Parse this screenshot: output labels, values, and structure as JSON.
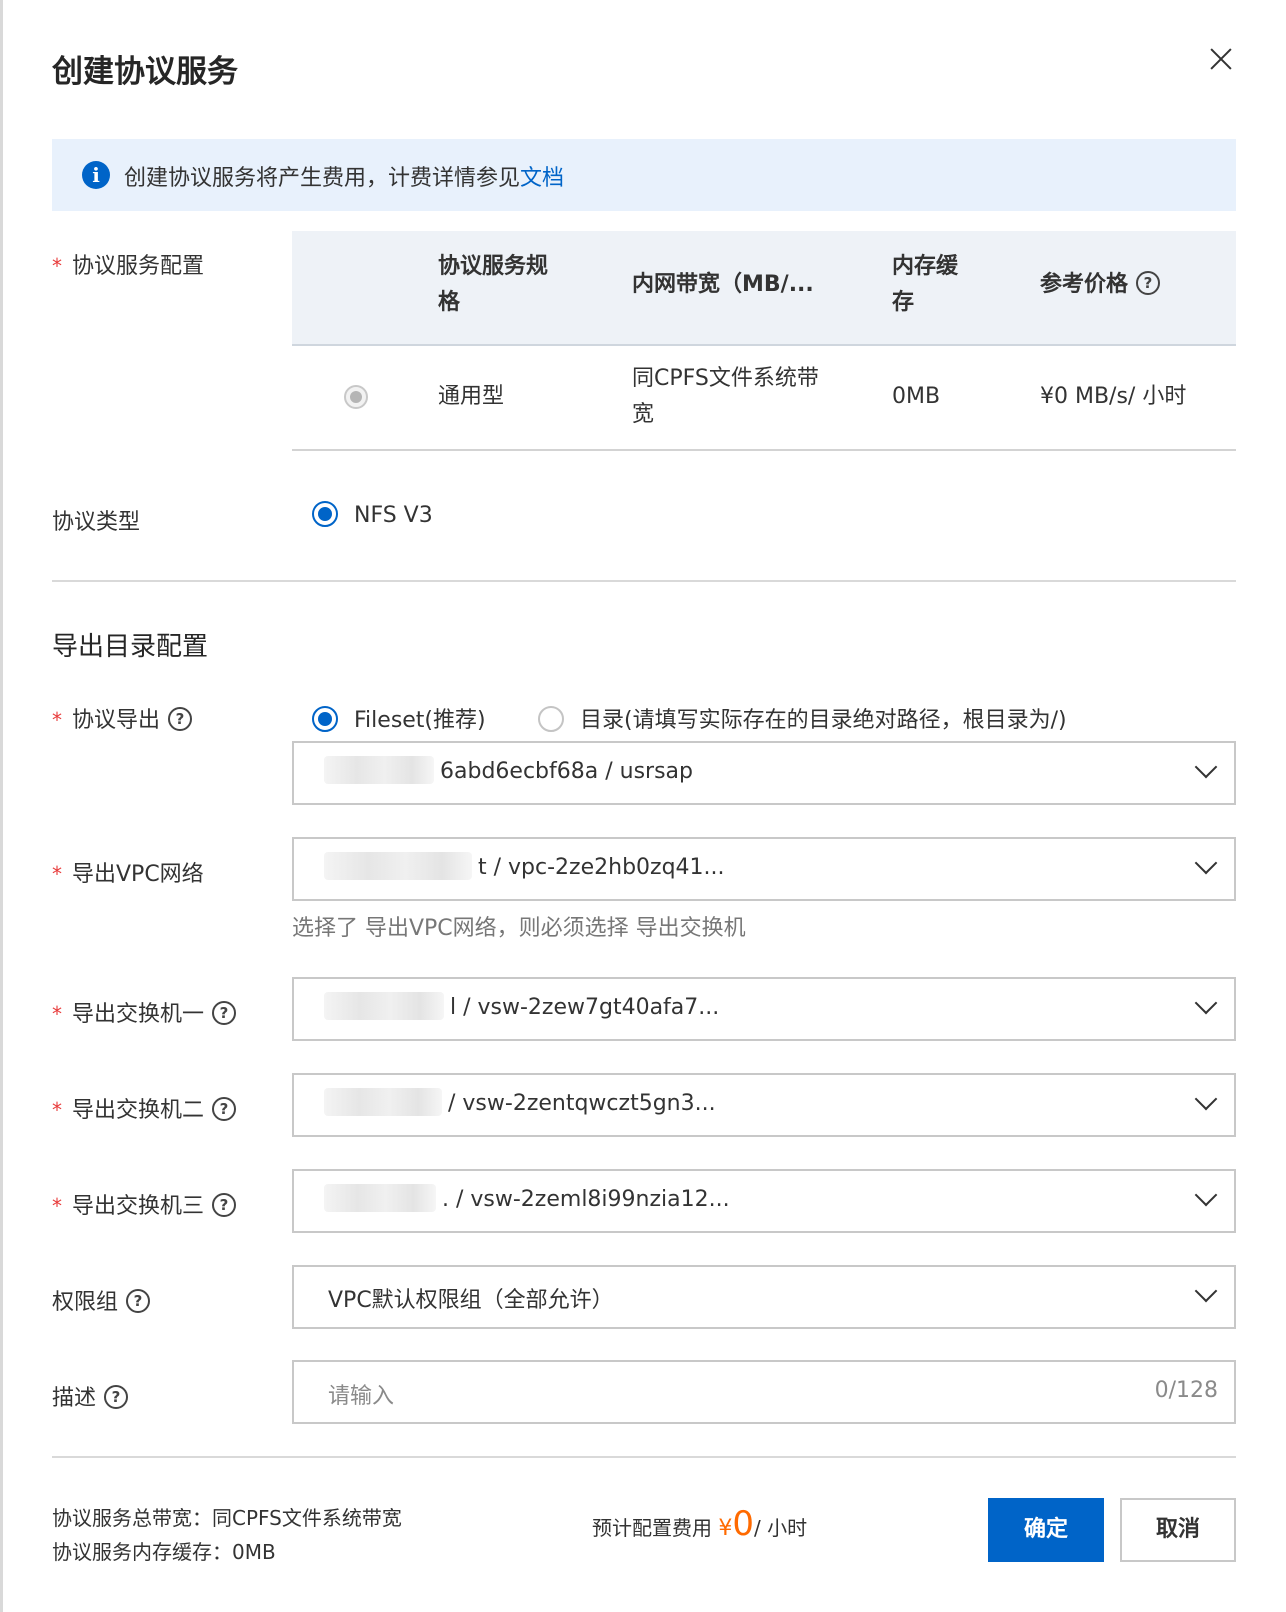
{
  "dialog": {
    "title": "创建协议服务"
  },
  "notice": {
    "text": "创建协议服务将产生费用，计费详情参见",
    "link": "文档"
  },
  "spec": {
    "label": "协议服务配置",
    "headers": [
      "协议服务规格",
      "内网带宽（MB/...",
      "内存缓存",
      "参考价格"
    ],
    "row": {
      "spec": "通用型",
      "bandwidth": "同CPFS文件系统带宽",
      "cache": "0MB",
      "price": "¥0 MB/s/ 小时"
    }
  },
  "protocol_type": {
    "label": "协议类型",
    "option": "NFS V3"
  },
  "export_section": {
    "title": "导出目录配置"
  },
  "protocol_export": {
    "label": "协议导出",
    "options": [
      "Fileset(推荐)",
      "目录(请填写实际存在的目录绝对路径，根目录为/)"
    ],
    "value": "6abd6ecbf68a / usrsap"
  },
  "vpc": {
    "label": "导出VPC网络",
    "value": "t / vpc-2ze2hb0zq41...",
    "hint": "选择了 导出VPC网络，则必须选择 导出交换机"
  },
  "vswitch1": {
    "label": "导出交换机一",
    "value": "l / vsw-2zew7gt40afa7..."
  },
  "vswitch2": {
    "label": "导出交换机二",
    "value": "/ vsw-2zentqwczt5gn3..."
  },
  "vswitch3": {
    "label": "导出交换机三",
    "value": ". / vsw-2zeml8i99nzia12..."
  },
  "permission_group": {
    "label": "权限组",
    "value": "VPC默认权限组（全部允许）"
  },
  "description": {
    "label": "描述",
    "placeholder": "请输入",
    "count": "0/128"
  },
  "footer": {
    "total_bandwidth": "协议服务总带宽：同CPFS文件系统带宽",
    "memory_cache": "协议服务内存缓存：0MB",
    "price_label": "预计配置费用",
    "price_currency": "¥",
    "price_amount": "0",
    "price_unit": "/ 小时",
    "confirm": "确定",
    "cancel": "取消"
  },
  "colors": {
    "primary": "#0064c8",
    "required": "#e83b3b",
    "price": "#ff6a00",
    "notice_bg": "#e8f1fc"
  }
}
